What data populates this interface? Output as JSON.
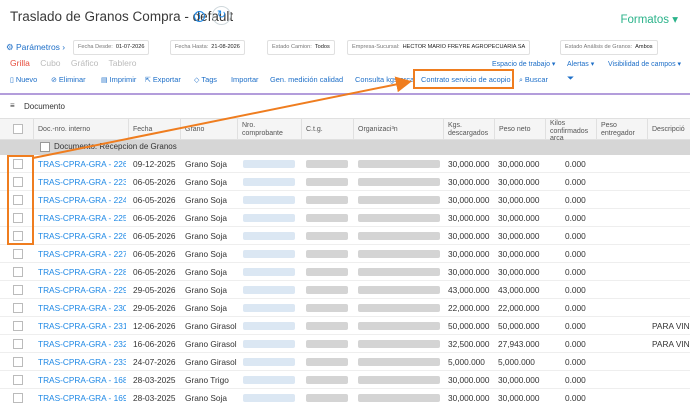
{
  "header": {
    "title": "Traslado de Granos Compra - default",
    "info_icon": "info-icon",
    "refresh_icon": "refresh-icon",
    "formatos": "Formatos"
  },
  "params": {
    "link": "Parámetros",
    "fecha_desde_label": "Fecha Desde:",
    "fecha_desde": "01-07-2026",
    "fecha_hasta_label": "Fecha Hasta:",
    "fecha_hasta": "21-08-2026",
    "estado_camion_label": "Estado Camion:",
    "estado_camion": "Todos",
    "empresa_label": "Empresa-Sucursal:",
    "empresa": "HECTOR MARIO FREYRE AGROPECUARIA SA",
    "estado_analisis_label": "Estado Análisis de Granos:",
    "estado_analisis": "Ambos"
  },
  "views": {
    "grilla": "Grilla",
    "cubo": "Cubo",
    "grafico": "Gráfico",
    "tablero": "Tablero",
    "espacio": "Espacio de trabajo",
    "alertas": "Alertas",
    "visibilidad": "Visibilidad de campos"
  },
  "toolbar": {
    "nuevo": "Nuevo",
    "eliminar": "Eliminar",
    "imprimir": "Imprimir",
    "exportar": "Exportar",
    "tags": "Tags",
    "importar": "Importar",
    "gen_medicion": "Gen. medición calidad",
    "consulta_kgs": "Consulta kgs arca",
    "contrato": "Contrato servicio de acopio",
    "buscar": "Buscar"
  },
  "documento_label": "Documento",
  "columns": {
    "doc": "Doc.-nro. interno",
    "fecha": "Fecha",
    "grano": "Grano",
    "nro_comp_1": "Nro.",
    "nro_comp_2": "comprobante",
    "ctg": "C.t.g.",
    "organizacion": "Organizaci³n",
    "kgs_1": "Kgs.",
    "kgs_2": "descargados",
    "peso_neto": "Peso neto",
    "kilos_1": "Kilos",
    "kilos_2": "confirmados",
    "kilos_3": "arca",
    "peso_ent_1": "Peso",
    "peso_ent_2": "entregador",
    "descripcion": "Descripció"
  },
  "group_label": "Documento: Recepcion de Granos",
  "rows": [
    {
      "doc": "TRAS-CPRA-GRA - 226",
      "fecha": "09-12-2025",
      "grano": "Grano Soja",
      "kgs": "30,000.000",
      "neto": "30,000.000",
      "kilos": "0.000",
      "desc": ""
    },
    {
      "doc": "TRAS-CPRA-GRA - 223",
      "fecha": "06-05-2026",
      "grano": "Grano Soja",
      "kgs": "30,000.000",
      "neto": "30,000.000",
      "kilos": "0.000",
      "desc": ""
    },
    {
      "doc": "TRAS-CPRA-GRA - 224",
      "fecha": "06-05-2026",
      "grano": "Grano Soja",
      "kgs": "30,000.000",
      "neto": "30,000.000",
      "kilos": "0.000",
      "desc": ""
    },
    {
      "doc": "TRAS-CPRA-GRA - 225",
      "fecha": "06-05-2026",
      "grano": "Grano Soja",
      "kgs": "30,000.000",
      "neto": "30,000.000",
      "kilos": "0.000",
      "desc": ""
    },
    {
      "doc": "TRAS-CPRA-GRA - 226",
      "fecha": "06-05-2026",
      "grano": "Grano Soja",
      "kgs": "30,000.000",
      "neto": "30,000.000",
      "kilos": "0.000",
      "desc": ""
    },
    {
      "doc": "TRAS-CPRA-GRA - 227",
      "fecha": "06-05-2026",
      "grano": "Grano Soja",
      "kgs": "30,000.000",
      "neto": "30,000.000",
      "kilos": "0.000",
      "desc": ""
    },
    {
      "doc": "TRAS-CPRA-GRA - 228",
      "fecha": "06-05-2026",
      "grano": "Grano Soja",
      "kgs": "30,000.000",
      "neto": "30,000.000",
      "kilos": "0.000",
      "desc": ""
    },
    {
      "doc": "TRAS-CPRA-GRA - 229",
      "fecha": "29-05-2026",
      "grano": "Grano Soja",
      "kgs": "43,000.000",
      "neto": "43,000.000",
      "kilos": "0.000",
      "desc": ""
    },
    {
      "doc": "TRAS-CPRA-GRA - 230",
      "fecha": "29-05-2026",
      "grano": "Grano Soja",
      "kgs": "22,000.000",
      "neto": "22,000.000",
      "kilos": "0.000",
      "desc": ""
    },
    {
      "doc": "TRAS-CPRA-GRA - 231",
      "fecha": "12-06-2026",
      "grano": "Grano Girasol",
      "kgs": "50,000.000",
      "neto": "50,000.000",
      "kilos": "0.000",
      "desc": "PARA VINCULAR"
    },
    {
      "doc": "TRAS-CPRA-GRA - 232",
      "fecha": "16-06-2026",
      "grano": "Grano Girasol",
      "kgs": "32,500.000",
      "neto": "27,943.000",
      "kilos": "0.000",
      "desc": "PARA VINCULAR"
    },
    {
      "doc": "TRAS-CPRA-GRA - 233",
      "fecha": "24-07-2026",
      "grano": "Grano Girasol",
      "kgs": "5,000.000",
      "neto": "5,000.000",
      "kilos": "0.000",
      "desc": ""
    },
    {
      "doc": "TRAS-CPRA-GRA - 168",
      "fecha": "28-03-2025",
      "grano": "Grano Trigo",
      "kgs": "30,000.000",
      "neto": "30,000.000",
      "kilos": "0.000",
      "desc": ""
    },
    {
      "doc": "TRAS-CPRA-GRA - 169",
      "fecha": "28-03-2025",
      "grano": "Grano Soja",
      "kgs": "30,000.000",
      "neto": "30,000.000",
      "kilos": "0.000",
      "desc": ""
    }
  ],
  "accent_color": "#ef7d1f",
  "link_color": "#1e88e5"
}
